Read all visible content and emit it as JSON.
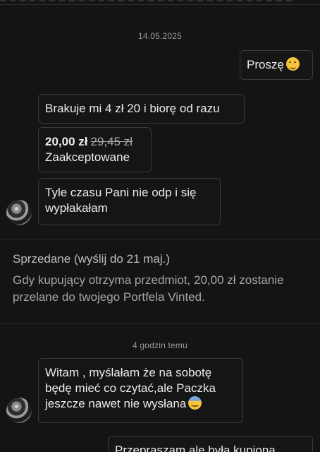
{
  "chat": {
    "date_1": "14.05.2025",
    "date_2": "4 godzin temu",
    "messages": {
      "m1": "Proszę",
      "m2": "Brakuje mi 4 zł 20 i biorę od razu",
      "offer_price_new": "20,00 zł",
      "offer_price_old": "29,45 zł",
      "offer_status": "Zaakceptowane",
      "m3": "Tyle czasu Pani nie odp i się wypłakałam",
      "m4": "Witam , myślałam że na sobotę będę mieć co czytać,ale Paczka jeszcze nawet nie wysłana",
      "m5": "Przepraszam ale była kupiona"
    },
    "emoji": {
      "m1": "smiling-face-icon",
      "m4": "sweat-face-icon"
    }
  },
  "sold_notice": {
    "title": "Sprzedane (wyślij do 21 maj.)",
    "body": "Gdy kupujący otrzyma przedmiot, 20,00 zł zostanie przelane do twojego Portfela Vinted."
  }
}
